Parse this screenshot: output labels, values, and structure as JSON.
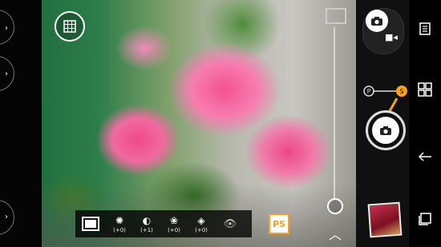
{
  "left_controls": {
    "buttons": [
      "side-button-top",
      "side-button-middle",
      "side-button-bottom"
    ]
  },
  "toolbar": {
    "items": [
      {
        "icon": "aspect-ratio-icon",
        "value": ""
      },
      {
        "icon": "exposure-icon",
        "value": "(+0)"
      },
      {
        "icon": "contrast-icon",
        "value": "(+1)"
      },
      {
        "icon": "saturation-icon",
        "value": "(+0)"
      },
      {
        "icon": "sharpness-icon",
        "value": "(+0)"
      },
      {
        "icon": "eye-icon",
        "value": ""
      }
    ]
  },
  "ps_badge": {
    "label": "PS"
  },
  "ps_toggle": {
    "left": "P",
    "right": "S"
  },
  "colors": {
    "accent": "#f6a21a",
    "panel": "#101010"
  }
}
